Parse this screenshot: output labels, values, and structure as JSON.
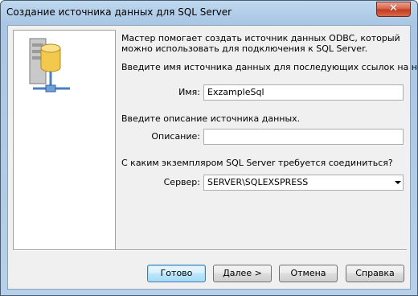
{
  "window": {
    "title": "Создание источника данных для SQL Server",
    "close_glyph": "✕"
  },
  "wizard": {
    "intro": "Мастер помогает создать источник данных ODBC, который можно использовать для подключения к SQL Server.",
    "name_prompt": "Введите имя источника данных для последующих ссылок на него.",
    "name_label": "Имя:",
    "name_value": "ExzampleSql",
    "description_prompt": "Введите описание источника данных.",
    "description_label": "Описание:",
    "description_value": "",
    "server_prompt": "С каким экземпляром SQL Server требуется соединиться?",
    "server_label": "Сервер:",
    "server_value": "SERVER\\SQLEXSPRESS"
  },
  "buttons": {
    "finish": "Готово",
    "next": "Далее >",
    "cancel": "Отмена",
    "help": "Справка"
  },
  "icons": {
    "graphic": "database-server-icon",
    "close": "close-icon",
    "combo": "chevron-down-icon"
  }
}
